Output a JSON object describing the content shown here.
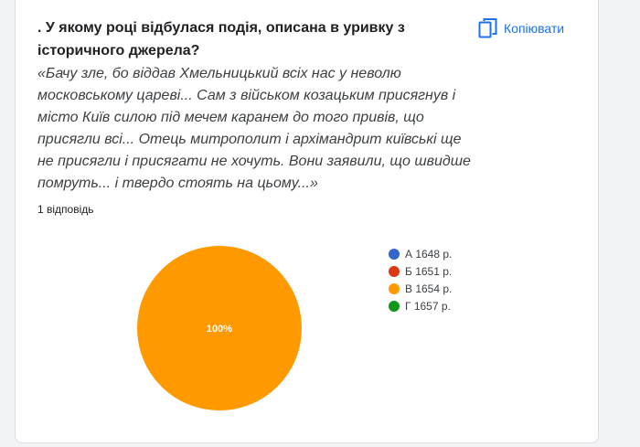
{
  "question": {
    "title": ". У якому році відбулася подія, описана в уривку з історичного джерела?",
    "excerpt": "«Бачу зле, бо віддав Хмельницький всіх нас у неволю московському цареві... Сам з військом козацьким присягнув і місто Київ силою під мечем каранем до того привів, що присягли всі... Отець митрополит і архімандрит київські ще не присягли і присягати не хочуть. Вони заявили, що швидше помруть... і твердо стоять на цьому...»",
    "responses_count": "1 відповідь"
  },
  "toolbar": {
    "copy_label": "Копіювати",
    "copy_icon": "copy-icon"
  },
  "colors": {
    "accent": "#1a73e8"
  },
  "chart_data": {
    "type": "pie",
    "categories": [
      "А 1648 р.",
      "Б 1651 р.",
      "В 1654 р.",
      "Г 1657 р."
    ],
    "values": [
      0,
      0,
      100,
      0
    ],
    "colors": [
      "#3366cc",
      "#dc3912",
      "#ff9900",
      "#109618"
    ],
    "slice_labels": [
      "",
      "",
      "100%",
      ""
    ],
    "legend_position": "right"
  }
}
